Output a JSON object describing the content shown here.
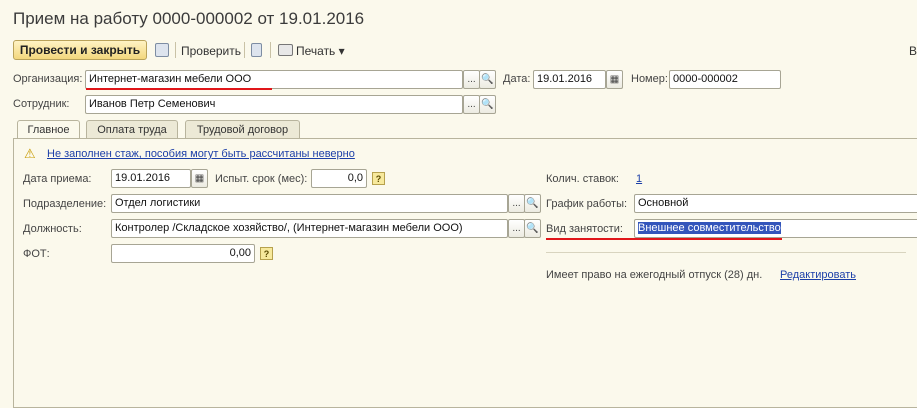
{
  "window": {
    "title": "Прием на работу 0000-000002 от 19.01.2016"
  },
  "toolbar": {
    "post_close_label": "Провести и закрыть",
    "check_label": "Проверить",
    "print_label": "Печать ▾",
    "right_edge_label": "В"
  },
  "header": {
    "org_label": "Организация:",
    "org_value": "Интернет-магазин мебели ООО",
    "date_label": "Дата:",
    "date_value": "19.01.2016",
    "number_label": "Номер:",
    "number_value": "0000-000002",
    "employee_label": "Сотрудник:",
    "employee_value": "Иванов Петр Семенович"
  },
  "tabs": [
    {
      "label": "Главное"
    },
    {
      "label": "Оплата труда"
    },
    {
      "label": "Трудовой договор"
    }
  ],
  "main": {
    "warning_text": "Не заполнен стаж, пособия могут быть рассчитаны неверно",
    "hire_date_label": "Дата приема:",
    "hire_date_value": "19.01.2016",
    "probation_label": "Испыт. срок (мес):",
    "probation_value": "0,0",
    "department_label": "Подразделение:",
    "department_value": "Отдел логистики",
    "position_label": "Должность:",
    "position_value": "Контролер /Складское хозяйство/, (Интернет-магазин мебели ООО)",
    "fot_label": "ФОТ:",
    "fot_value": "0,00",
    "rates_label": "Колич. ставок:",
    "rates_value": "1",
    "schedule_label": "График работы:",
    "schedule_value": "Основной",
    "employment_type_label": "Вид занятости:",
    "employment_type_value": "Внешнее совместительство",
    "vacation_text": "Имеет право на ежегодный отпуск (28) дн.",
    "edit_link": "Редактировать",
    "help_glyph": "?"
  },
  "icons": {
    "ellipsis": "...",
    "search": "🔍",
    "calendar": "▦",
    "warning": "⚠"
  },
  "colors": {
    "background": "#fbf9ec",
    "primary_button": "#f3d77d",
    "link": "#1c3fa8",
    "annotation_red": "#e0161a",
    "selection": "#3355bb"
  }
}
